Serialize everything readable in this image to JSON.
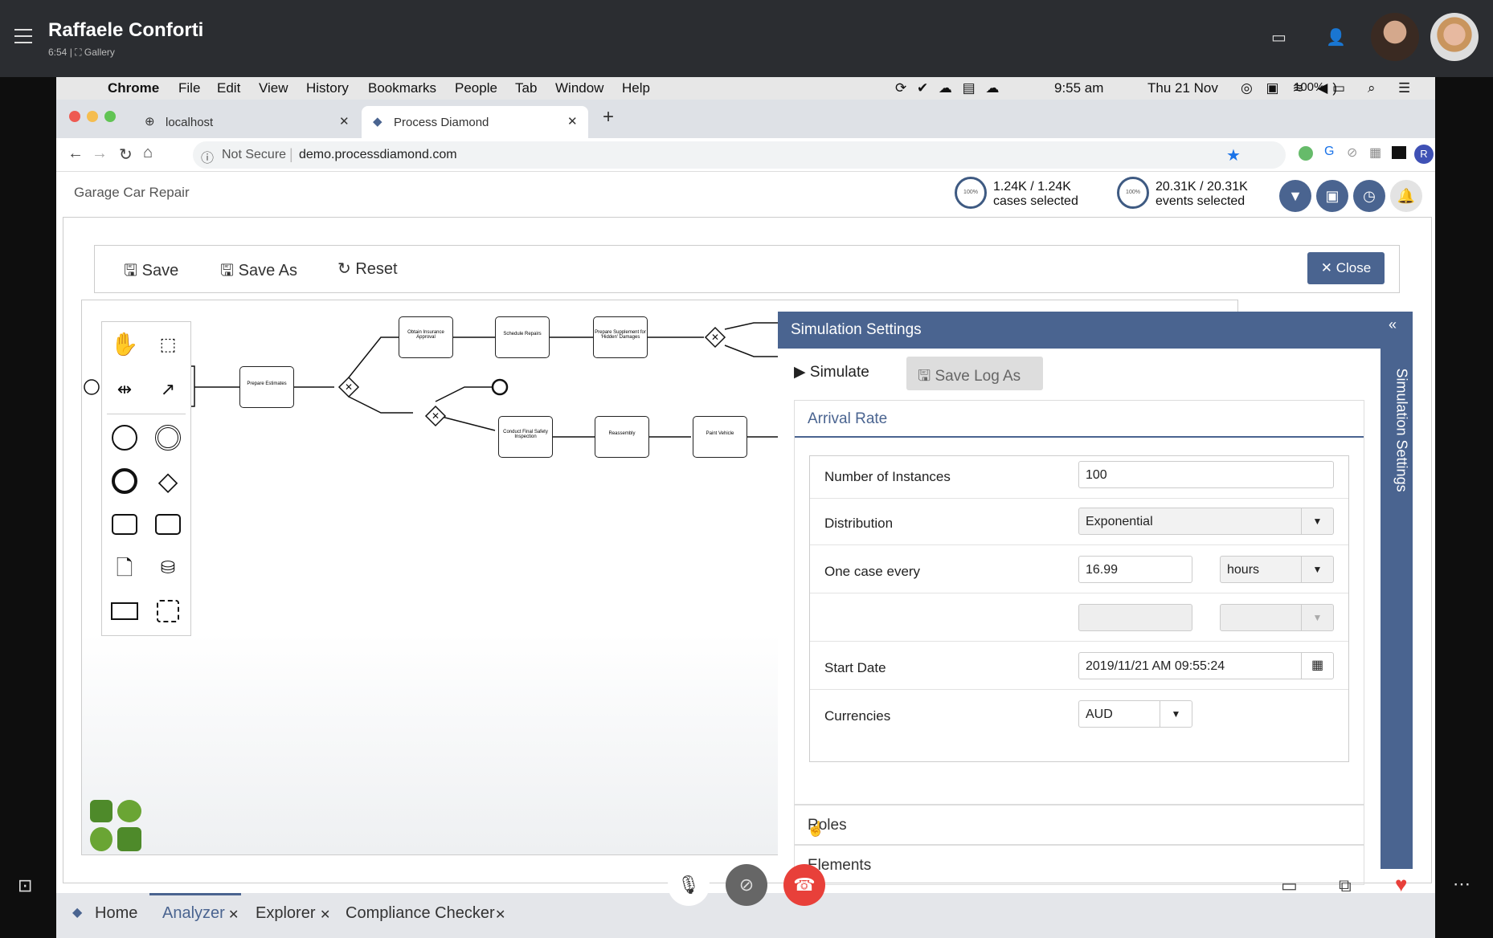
{
  "call": {
    "caller_name": "Raffaele Conforti",
    "duration": "6:54",
    "separator": "|",
    "gallery_label": "Gallery"
  },
  "mac_menu": {
    "app": "Chrome",
    "items": [
      "File",
      "Edit",
      "View",
      "History",
      "Bookmarks",
      "People",
      "Tab",
      "Window",
      "Help"
    ],
    "time": "9:55 am",
    "date": "Thu 21 Nov",
    "battery": "100%"
  },
  "browser": {
    "tabs": [
      {
        "label": "localhost"
      },
      {
        "label": "Process Diamond"
      }
    ],
    "not_secure": "Not Secure",
    "url": "demo.processdiamond.com",
    "profile_initial": "R"
  },
  "app": {
    "title": "Garage Car Repair",
    "cases": {
      "gauge": "100%",
      "value": "1.24K / 1.24K",
      "label": "cases selected"
    },
    "events": {
      "gauge": "100%",
      "value": "20.31K / 20.31K",
      "label": "events selected"
    }
  },
  "toolbar": {
    "save": "Save",
    "save_as": "Save As",
    "reset": "Reset",
    "close": "Close"
  },
  "diagram": {
    "tasks": {
      "prepare_estimates": "Prepare Estimates",
      "obtain_insurance": "Obtain Insurance Approval",
      "schedule_repairs": "Schedule Repairs",
      "prepare_supplement": "Prepare Supplement for 'Hidden' Damages",
      "conduct_inspection": "Conduct Final Safety Inspection",
      "reassembly": "Reassembly",
      "paint_vehicle": "Paint Vehicle"
    }
  },
  "simulation": {
    "header": "Simulation Settings",
    "side_label": "Simulation Settings",
    "simulate": "Simulate",
    "save_log_as": "Save Log As",
    "arrival_rate": "Arrival Rate",
    "fields": {
      "instances_label": "Number of Instances",
      "instances_value": "100",
      "distribution_label": "Distribution",
      "distribution_value": "Exponential",
      "one_case_label": "One case every",
      "one_case_value": "16.99",
      "one_case_unit": "hours",
      "start_date_label": "Start Date",
      "start_date_value": "2019/11/21 AM 09:55:24",
      "currencies_label": "Currencies",
      "currencies_value": "AUD"
    },
    "roles": "Roles",
    "elements": "Elements"
  },
  "bottom_tabs": [
    {
      "label": "Home"
    },
    {
      "label": "Analyzer"
    },
    {
      "label": "Explorer"
    },
    {
      "label": "Compliance Checker"
    }
  ],
  "colors": {
    "accent": "#4a6490",
    "call_bar": "#2b2d31",
    "hangup": "#e8403a"
  }
}
